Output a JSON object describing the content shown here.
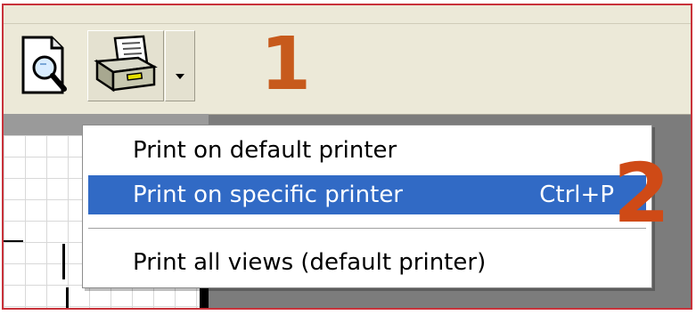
{
  "toolbar": {
    "buttons": [
      {
        "icon": "print-preview-icon"
      },
      {
        "icon": "printer-icon"
      },
      {
        "icon": "chevron-down-icon"
      }
    ]
  },
  "callouts": {
    "step1": "1",
    "step2": "2"
  },
  "menu": {
    "items": [
      {
        "label": "Print on default printer",
        "shortcut": ""
      },
      {
        "label": "Print on specific printer",
        "shortcut": "Ctrl+P",
        "highlighted": true
      },
      {
        "label": "Print all views (default printer)",
        "shortcut": ""
      }
    ]
  },
  "colors": {
    "highlight": "#316ac5",
    "callout": "#c75a1c",
    "toolbar": "#ece9d8"
  }
}
